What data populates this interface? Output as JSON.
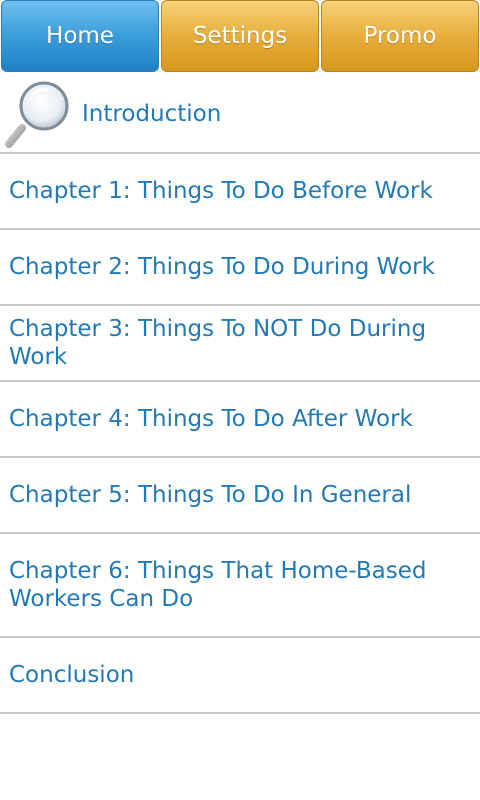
{
  "tabs": [
    {
      "label": "Home",
      "active": true
    },
    {
      "label": "Settings",
      "active": false
    },
    {
      "label": "Promo",
      "active": false
    }
  ],
  "list": {
    "intro": {
      "label": "Introduction",
      "icon": "magnifier-icon"
    },
    "chapters": [
      "Chapter 1: Things To Do Before Work",
      "Chapter 2: Things To Do During Work",
      "Chapter 3: Things To NOT Do During Work",
      "Chapter 4: Things To Do After Work",
      "Chapter 5: Things To Do In General",
      "Chapter 6: Things That Home-Based Workers Can Do"
    ],
    "conclusion": "Conclusion"
  },
  "colors": {
    "active_tab": "#3b9ddb",
    "inactive_tab": "#e6ae3a",
    "link_text": "#2279b4",
    "divider": "#c6c6c6"
  }
}
